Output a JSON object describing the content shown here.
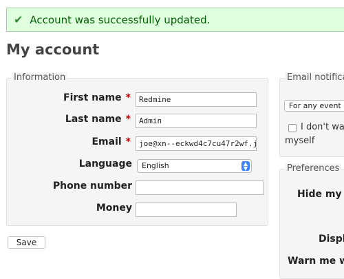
{
  "flash": {
    "message": "Account was successfully updated."
  },
  "page": {
    "title": "My account"
  },
  "information": {
    "legend": "Information",
    "fields": [
      {
        "label": "First name",
        "required": "*",
        "value": "Redmine"
      },
      {
        "label": "Last name",
        "required": "*",
        "value": "Admin"
      },
      {
        "label": "Email",
        "required": "*",
        "value": "joe@xn--eckwd4c7cu47r2wf.j"
      }
    ],
    "language": {
      "label": "Language",
      "value": "English"
    },
    "phone": {
      "label": "Phone number",
      "value": ""
    },
    "money": {
      "label": "Money",
      "value": ""
    }
  },
  "save_label": "Save",
  "email_notifications": {
    "legend": "Email notifica",
    "select_value": "For any event o",
    "checkbox_label_1": "I don't wa",
    "checkbox_label_2": "myself"
  },
  "preferences": {
    "legend": "Preferences",
    "items": [
      "Hide my e",
      "Displa",
      "Warn me wh"
    ]
  },
  "colors": {
    "flash_bg": "#dfffdf",
    "required": "#bb0000",
    "select_arrow": "#3b82f6"
  },
  "icons": [
    "checkmark-icon",
    "select-arrow-icon"
  ]
}
